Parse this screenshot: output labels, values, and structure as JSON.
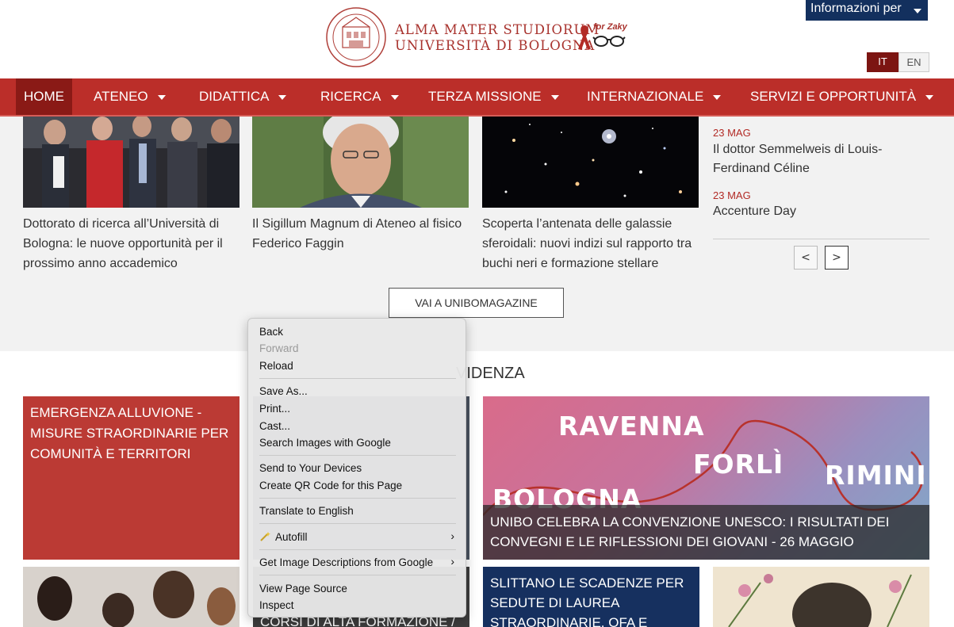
{
  "header": {
    "logo_line1": "ALMA MATER STUDIORUM",
    "logo_line2": "UNIVERSITÀ DI BOLOGNA",
    "logo_tag": "for Zaky",
    "info_button": "Informazioni per",
    "lang_it": "IT",
    "lang_en": "EN"
  },
  "nav": {
    "items": [
      {
        "label": "HOME"
      },
      {
        "label": "ATENEO"
      },
      {
        "label": "DIDATTICA"
      },
      {
        "label": "RICERCA"
      },
      {
        "label": "TERZA MISSIONE"
      },
      {
        "label": "INTERNAZIONALE"
      },
      {
        "label": "SERVIZI E OPPORTUNITÀ"
      }
    ]
  },
  "news": {
    "captions": [
      "Dottorato di ricerca all’Università di Bologna: le nuove opportunità per il prossimo anno accademico",
      "Il Sigillum Magnum di Ateneo al fisico Federico Faggin",
      "Scoperta l’antenata delle galassie sferoidali: nuovi indizi sul rapporto tra buchi neri e formazione stellare"
    ],
    "side": [
      {
        "date": "23 MAG",
        "title": "Il dottor Semmelweis di Louis-Ferdinand Céline"
      },
      {
        "date": "23 MAG",
        "title": "Accenture Day"
      }
    ],
    "prev_label": "<",
    "next_label": ">",
    "magazine_button": "VAI A UNIBOMAGAZINE"
  },
  "evidenza": {
    "title_visible": "VIDENZA",
    "alluvione": "EMERGENZA ALLUVIONE - MISURE STRAORDINARIE PER COMUNITÀ E TERRITORI",
    "cities": [
      "RAVENNA",
      "FORLÌ",
      "RIMINI",
      "BOLOGNA"
    ],
    "cities_caption": "UNIBO CELEBRA LA CONVENZIONE UNESCO: I RISULTATI DEI CONVEGNI E LE RIFLESSIONI DEI GIOVANI - 26 MAGGIO",
    "corsi": "CORSI DI ALTA FORMAZIONE /",
    "scadenze": "SLITTANO LE SCADENZE PER SEDUTE DI LAUREA STRAORDINARIE, OFA E"
  },
  "context_menu": {
    "back": "Back",
    "forward": "Forward",
    "reload": "Reload",
    "save_as": "Save As...",
    "print": "Print...",
    "cast": "Cast...",
    "search_images": "Search Images with Google",
    "send_devices": "Send to Your Devices",
    "qr_code": "Create QR Code for this Page",
    "translate": "Translate to English",
    "autofill": "Autofill",
    "image_descriptions": "Get Image Descriptions from Google",
    "view_source": "View Page Source",
    "inspect": "Inspect"
  },
  "colors": {
    "brand_red": "#bb2e29",
    "dark_red": "#8a1a16",
    "navy": "#13305e"
  }
}
